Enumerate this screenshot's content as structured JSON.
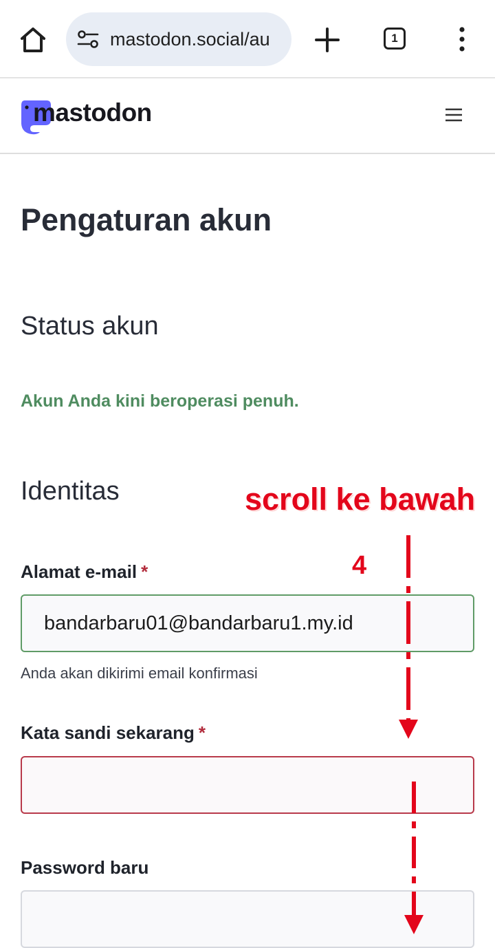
{
  "browser": {
    "url": "mastodon.social/au",
    "tab_count": "1",
    "icons": [
      "home-icon",
      "site-settings-icon",
      "new-tab-icon",
      "tab-switcher-icon",
      "more-menu-icon"
    ]
  },
  "site": {
    "logo_text": "mastodon",
    "menu_icon": "hamburger-icon"
  },
  "page": {
    "title": "Pengaturan akun",
    "status_section": {
      "heading": "Status akun",
      "message": "Akun Anda kini beroperasi penuh.",
      "message_color": "#4f8c60"
    },
    "identity_section": {
      "heading": "Identitas",
      "email": {
        "label": "Alamat e-mail",
        "required_mark": "*",
        "value": "bandarbaru01@bandarbaru1.my.id",
        "hint": "Anda akan dikirimi email konfirmasi"
      },
      "current_password": {
        "label": "Kata sandi sekarang",
        "required_mark": "*",
        "value": ""
      },
      "new_password": {
        "label": "Password baru",
        "value": ""
      }
    }
  },
  "annotation": {
    "text": "scroll ke bawah",
    "step_number": "4",
    "color": "#e3061b"
  },
  "colors": {
    "brand": "#6364ff",
    "required": "#b22c3c",
    "valid_border": "#5f9b66",
    "invalid_border": "#b8394a"
  }
}
